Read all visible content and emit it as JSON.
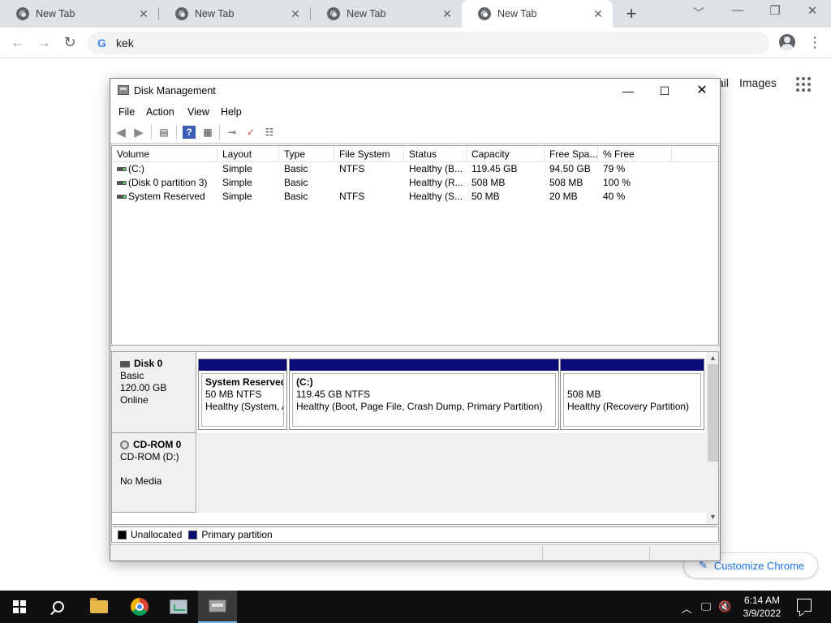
{
  "browser": {
    "tabs": [
      {
        "title": "New Tab"
      },
      {
        "title": "New Tab"
      },
      {
        "title": "New Tab"
      },
      {
        "title": "New Tab"
      }
    ],
    "omnibox_text": "kek",
    "ntp": {
      "gmail_label": "ail",
      "images_label": "Images",
      "customize_label": "Customize Chrome"
    }
  },
  "disk_management": {
    "title": "Disk Management",
    "menus": [
      "File",
      "Action",
      "View",
      "Help"
    ],
    "columns": [
      "Volume",
      "Layout",
      "Type",
      "File System",
      "Status",
      "Capacity",
      "Free Spa...",
      "% Free"
    ],
    "volumes": [
      {
        "volume": "(C:)",
        "layout": "Simple",
        "type": "Basic",
        "fs": "NTFS",
        "status": "Healthy (B...",
        "capacity": "119.45 GB",
        "free": "94.50 GB",
        "pct": "79 %"
      },
      {
        "volume": "(Disk 0 partition 3)",
        "layout": "Simple",
        "type": "Basic",
        "fs": "",
        "status": "Healthy (R...",
        "capacity": "508 MB",
        "free": "508 MB",
        "pct": "100 %"
      },
      {
        "volume": "System Reserved",
        "layout": "Simple",
        "type": "Basic",
        "fs": "NTFS",
        "status": "Healthy (S...",
        "capacity": "50 MB",
        "free": "20 MB",
        "pct": "40 %"
      }
    ],
    "disks": [
      {
        "name": "Disk 0",
        "lines": [
          "Basic",
          "120.00 GB",
          "Online"
        ],
        "partitions": [
          {
            "title": "System Reserved",
            "size": "50 MB NTFS",
            "status": "Healthy (System, A"
          },
          {
            "title": "(C:)",
            "size": "119.45 GB NTFS",
            "status": "Healthy (Boot, Page File, Crash Dump, Primary Partition)"
          },
          {
            "title": "",
            "size": "508 MB",
            "status": "Healthy (Recovery Partition)"
          }
        ]
      },
      {
        "name": "CD-ROM 0",
        "lines": [
          "CD-ROM (D:)",
          "",
          "No Media"
        ]
      }
    ],
    "legend": [
      {
        "label": "Unallocated",
        "color": "#000000"
      },
      {
        "label": "Primary partition",
        "color": "#0a0a78"
      }
    ]
  },
  "taskbar": {
    "time": "6:14 AM",
    "date": "3/9/2022"
  }
}
